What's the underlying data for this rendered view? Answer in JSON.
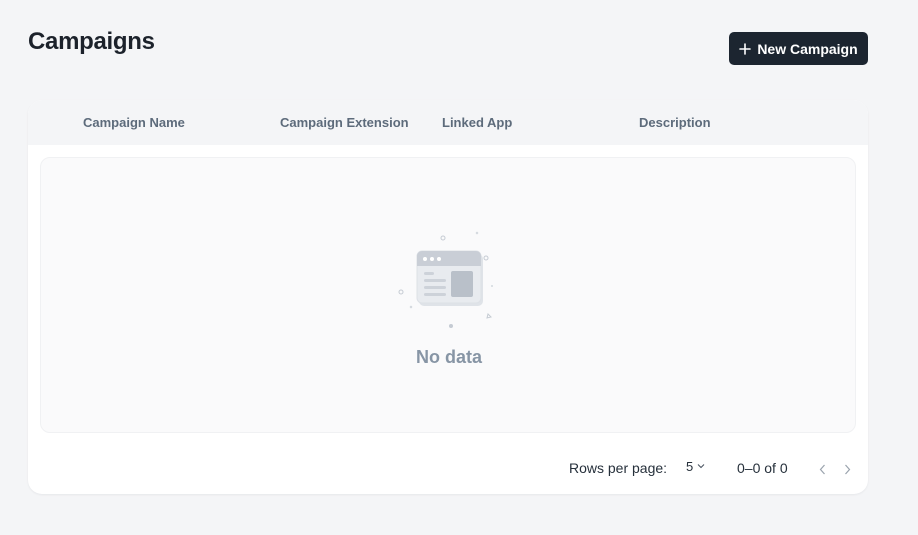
{
  "header": {
    "title": "Campaigns",
    "new_button_label": "New Campaign"
  },
  "table": {
    "columns": [
      "Campaign Name",
      "Campaign Extension",
      "Linked App",
      "Description"
    ],
    "rows": [],
    "empty_text": "No data"
  },
  "pagination": {
    "rows_per_page_label": "Rows per page:",
    "rows_per_page_value": "5",
    "range_text": "0–0 of 0"
  },
  "colors": {
    "primary_button": "#1c2530",
    "background": "#f4f5f7",
    "empty_text": "#8795a5"
  },
  "icons": {
    "new_button": "plus-icon",
    "empty_state": "empty-document-icon",
    "rows_select": "chevron-down-icon",
    "prev": "chevron-left-icon",
    "next": "chevron-right-icon"
  }
}
